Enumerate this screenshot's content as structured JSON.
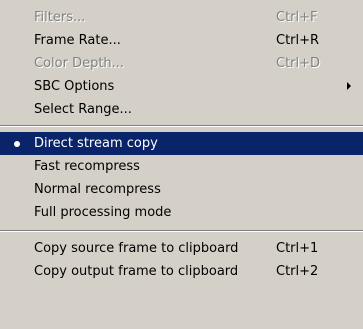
{
  "menu": {
    "items": [
      {
        "label": "Filters...",
        "shortcut": "Ctrl+F",
        "disabled": true
      },
      {
        "label": "Frame Rate...",
        "shortcut": "Ctrl+R",
        "disabled": false
      },
      {
        "label": "Color Depth...",
        "shortcut": "Ctrl+D",
        "disabled": true
      },
      {
        "label": "SBC Options",
        "shortcut": "",
        "disabled": false,
        "submenu": true
      },
      {
        "label": "Select Range...",
        "shortcut": "",
        "disabled": false
      },
      {
        "label": "Direct stream copy",
        "shortcut": "",
        "checked": true,
        "highlighted": true
      },
      {
        "label": "Fast recompress",
        "shortcut": ""
      },
      {
        "label": "Normal recompress",
        "shortcut": ""
      },
      {
        "label": "Full processing mode",
        "shortcut": ""
      },
      {
        "label": "Copy source frame to clipboard",
        "shortcut": "Ctrl+1"
      },
      {
        "label": "Copy output frame to clipboard",
        "shortcut": "Ctrl+2"
      }
    ]
  },
  "colors": {
    "menu_background": "#d4d0c8",
    "highlight_background": "#0a246a",
    "highlight_text": "#ffffff",
    "disabled_text": "#808080"
  },
  "icons": {
    "submenu_arrow": "chevron-right-icon",
    "radio_check": "bullet-icon"
  }
}
